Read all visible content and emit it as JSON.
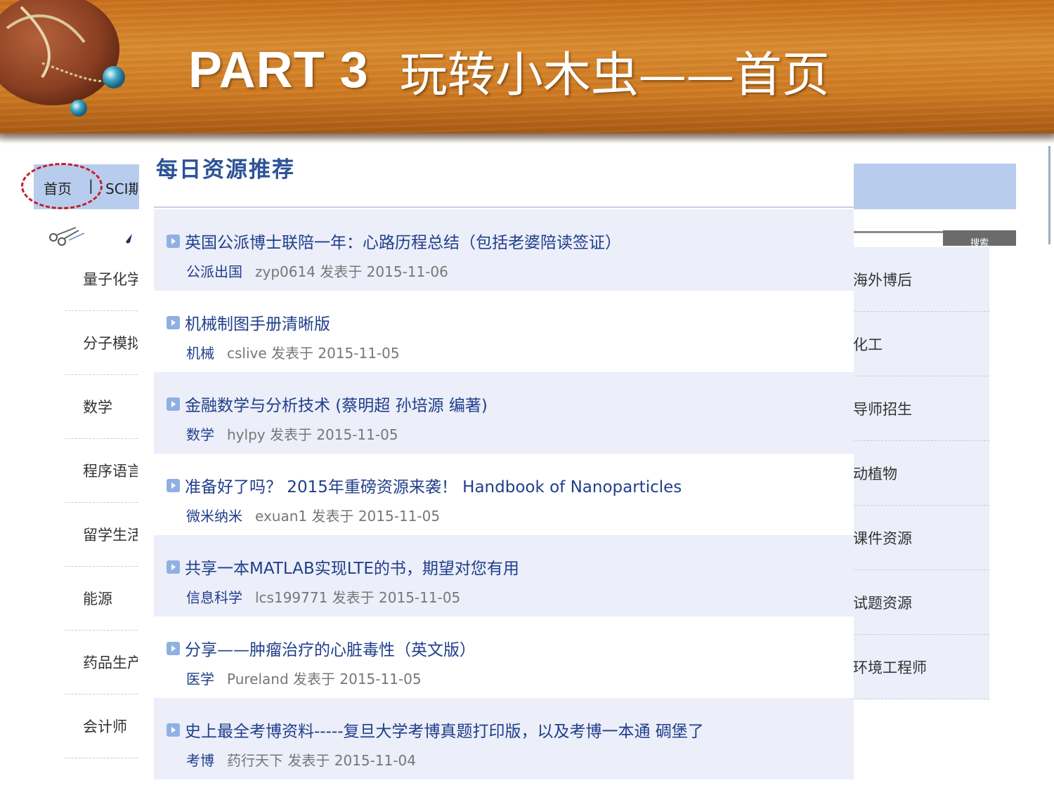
{
  "slide": {
    "part_label": "PART 3",
    "title": "玩转小木虫——首页"
  },
  "site_nav": {
    "home": "首页",
    "separator": "|",
    "next_item": "SCI期"
  },
  "sidebar_left": {
    "items": [
      {
        "label": "量子化学"
      },
      {
        "label": "分子模拟"
      },
      {
        "label": "数学"
      },
      {
        "label": "程序语言"
      },
      {
        "label": "留学生活"
      },
      {
        "label": "能源"
      },
      {
        "label": "药品生产"
      },
      {
        "label": "会计师"
      }
    ]
  },
  "search": {
    "button_label": "搜索"
  },
  "sidebar_right": {
    "items": [
      {
        "label": "海外博后"
      },
      {
        "label": "化工"
      },
      {
        "label": "导师招生"
      },
      {
        "label": "动植物"
      },
      {
        "label": "课件资源"
      },
      {
        "label": "试题资源"
      },
      {
        "label": "环境工程师"
      }
    ]
  },
  "recommendations": {
    "heading": "每日资源推荐",
    "items": [
      {
        "title": "英国公派博士联陪一年：心路历程总结（包括老婆陪读签证）",
        "category": "公派出国",
        "byline": "zyp0614 发表于 2015-11-06"
      },
      {
        "title": "机械制图手册清晰版",
        "category": "机械",
        "byline": "cslive 发表于 2015-11-05"
      },
      {
        "title": "金融数学与分析技术 (蔡明超 孙培源 编著)",
        "category": "数学",
        "byline": "hylpy 发表于 2015-11-05"
      },
      {
        "title": "准备好了吗？ 2015年重磅资源来袭！ Handbook of Nanoparticles",
        "category": "微米纳米",
        "byline": "exuan1 发表于 2015-11-05"
      },
      {
        "title": "共享一本MATLAB实现LTE的书，期望对您有用",
        "category": "信息科学",
        "byline": "lcs199771 发表于 2015-11-05"
      },
      {
        "title": "分享——肿瘤治疗的心脏毒性（英文版）",
        "category": "医学",
        "byline": "Pureland 发表于 2015-11-05"
      },
      {
        "title": "史上最全考博资料-----复旦大学考博真题打印版，以及考博一本通 碉堡了",
        "category": "考博",
        "byline": "药行天下 发表于 2015-11-04"
      }
    ]
  },
  "colors": {
    "header_wood": "#cf7a22",
    "nav_bar": "#b8cdee",
    "link_blue": "#1f3f8a",
    "row_shade": "#eceef9",
    "highlight_circle": "#c2202a"
  }
}
